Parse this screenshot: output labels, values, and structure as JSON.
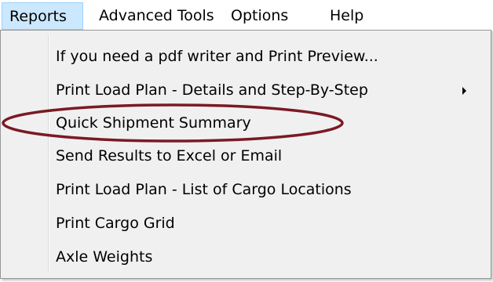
{
  "menubar": {
    "items": [
      {
        "label": "Reports"
      },
      {
        "label": "Advanced Tools"
      },
      {
        "label": "Options"
      },
      {
        "label": "Help"
      }
    ]
  },
  "reports_menu": {
    "items": [
      {
        "label": "If you need a pdf writer and Print Preview..."
      },
      {
        "label": "Print Load Plan - Details and Step-By-Step",
        "has_submenu": true
      },
      {
        "label": "Quick Shipment Summary",
        "highlighted_annotation": true
      },
      {
        "label": "Send Results to Excel or Email"
      },
      {
        "label": "Print Load Plan - List of Cargo Locations"
      },
      {
        "label": "Print Cargo Grid"
      },
      {
        "label": "Axle Weights"
      }
    ]
  },
  "colors": {
    "active_menu_bg": "#cce8ff",
    "active_menu_border": "#99d1ff",
    "dropdown_bg": "#f0f0f0",
    "annotation_ellipse": "#7a1a24"
  },
  "icons": {
    "submenu": "chevron-right-icon"
  }
}
